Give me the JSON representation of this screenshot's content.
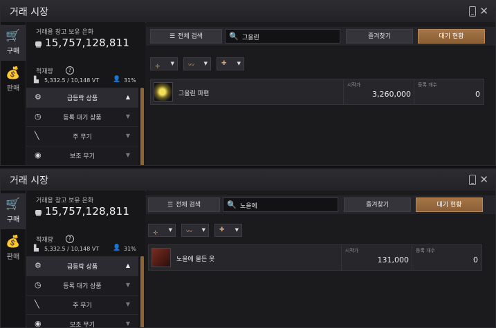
{
  "window": {
    "title": "거래 시장"
  },
  "tabs": [
    {
      "label": "구매",
      "icon": "cart-icon"
    },
    {
      "label": "판매",
      "icon": "money-bag-icon"
    }
  ],
  "sidebar": {
    "warehouse_label": "거래용 창고 보유 은화",
    "silver": "15,757,128,811",
    "load_label": "적재량",
    "weight": "5,332.5 / 10,148 VT",
    "weight_pct": "31%",
    "categories": [
      {
        "label": "급등락 상품",
        "icon": "gear-icon",
        "arrow": "▲"
      },
      {
        "label": "등록 대기 상품",
        "icon": "clock-icon",
        "arrow": "▼"
      },
      {
        "label": "주 무기",
        "icon": "sword-icon",
        "arrow": "▼"
      },
      {
        "label": "보조 무기",
        "icon": "shield-icon",
        "arrow": "▼"
      }
    ]
  },
  "toolbar": {
    "all_search_label": "전체 검색",
    "favorites_label": "즐겨찾기",
    "pending_label": "대기 현황"
  },
  "columns": {
    "start_price": "시작가",
    "listing_count": "등록 개수"
  },
  "panels": [
    {
      "search_value": "그을린",
      "item": {
        "name": "그을린 파편",
        "start_price": "3,260,000",
        "listing_count": "0"
      }
    },
    {
      "search_value": "노을에",
      "item": {
        "name": "노을에 물든 옷",
        "start_price": "131,000",
        "listing_count": "0"
      }
    }
  ],
  "colors": {
    "accent_gold": "#a57546",
    "scroll_gold": "#8d6533",
    "background": "#1a1a1e"
  }
}
